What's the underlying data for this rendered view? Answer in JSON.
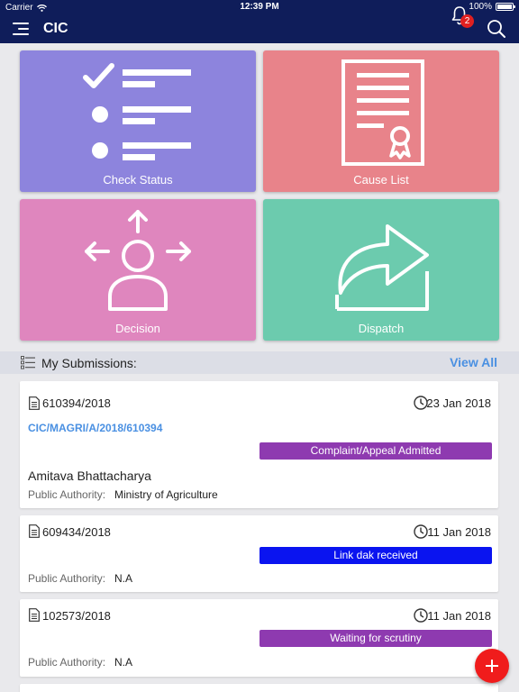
{
  "status_bar": {
    "carrier": "Carrier",
    "time": "12:39 PM",
    "battery": "100%"
  },
  "navbar": {
    "title": "CIC",
    "notification_count": "2",
    "icons": [
      "menu-icon",
      "bell-icon",
      "search-icon"
    ]
  },
  "tiles": [
    {
      "label": "Check Status",
      "icon": "checklist-icon",
      "color": "#8d84dd"
    },
    {
      "label": "Cause List",
      "icon": "certificate-document-icon",
      "color": "#e8838a"
    },
    {
      "label": "Decision",
      "icon": "person-arrows-icon",
      "color": "#df86be"
    },
    {
      "label": "Dispatch",
      "icon": "share-arrow-icon",
      "color": "#6ccbae"
    }
  ],
  "submissions": {
    "title": "My Submissions:",
    "view_all": "View All",
    "items": [
      {
        "ref": "610394/2018",
        "date": "23 Jan 2018",
        "case_no": "CIC/MAGRI/A/2018/610394",
        "status": "Complaint/Appeal Admitted",
        "status_color": "#8e3ab0",
        "name": "Amitava Bhattacharya",
        "pa_label": "Public Authority:",
        "pa_value": "Ministry of Agriculture"
      },
      {
        "ref": "609434/2018",
        "date": "11 Jan 2018",
        "status": "Link dak received",
        "status_color": "#0a14f0",
        "pa_label": "Public Authority:",
        "pa_value": "N.A"
      },
      {
        "ref": "102573/2018",
        "date": "11 Jan 2018",
        "status": "Waiting for scrutiny",
        "status_color": "#8e3ab0",
        "pa_label": "Public Authority:",
        "pa_value": "N.A"
      }
    ]
  },
  "fab": {
    "icon": "plus-icon",
    "color": "#f01c1c"
  }
}
